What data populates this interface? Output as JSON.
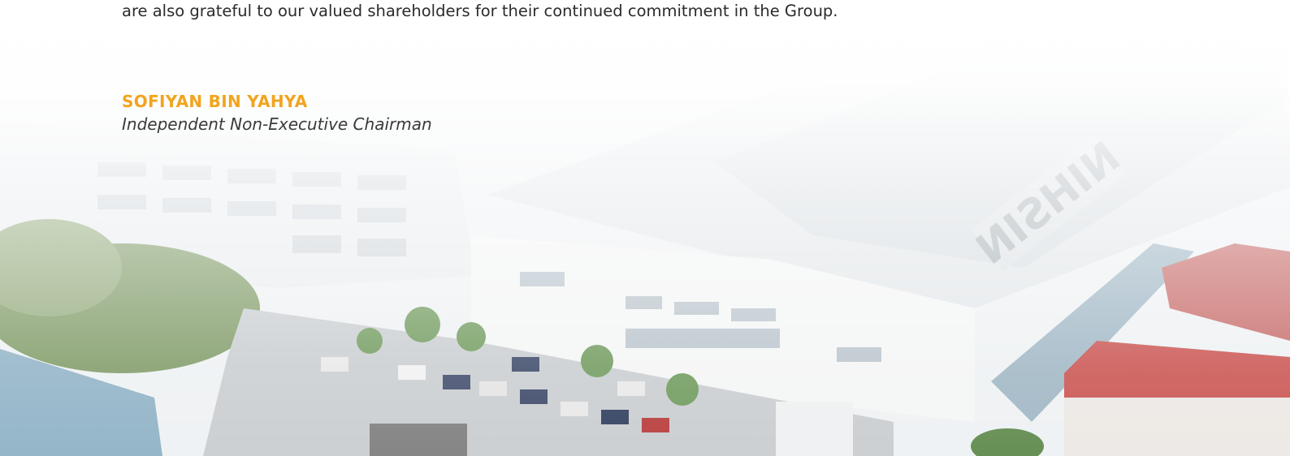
{
  "document": {
    "body_line": "are also grateful to our valued shareholders for their continued commitment in the Group.",
    "signature": {
      "name": "SOFIYAN BIN YAHYA",
      "title": "Independent Non-Executive Chairman"
    },
    "photo": {
      "roof_lettering": "NIHSIN"
    }
  },
  "colors": {
    "signature_name": "#f2a41e",
    "body_text": "#2b2b2b",
    "roof": "#dfe3e6",
    "red_roof": "#c9524f",
    "trees": "#6f8f56"
  }
}
